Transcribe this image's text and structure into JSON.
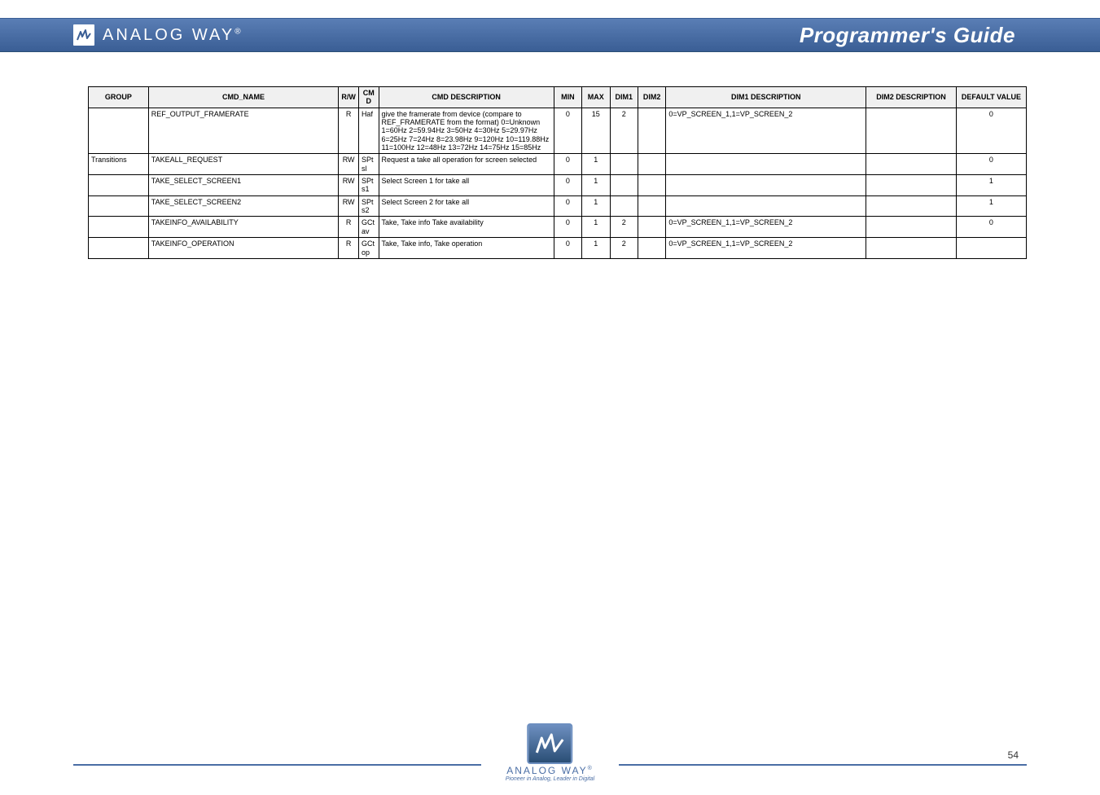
{
  "header": {
    "brand_text": "ANALOG WAY",
    "brand_reg": "®",
    "title": "Programmer's Guide"
  },
  "table": {
    "headers": {
      "group": "GROUP",
      "cmd_name": "CMD_NAME",
      "rw": "R/W",
      "cmd": "CMD",
      "cmd_descr": "CMD DESCRIPTION",
      "min": "MIN",
      "max": "MAX",
      "dim1": "DIM1",
      "dim2": "DIM2",
      "dim1_descr": "DIM1 DESCRIPTION",
      "dim2_descr": "DIM2 DESCRIPTION",
      "default": "DEFAULT VALUE"
    },
    "rows": [
      {
        "group": "",
        "cmd_name": "REF_OUTPUT_FRAMERATE",
        "rw": "R",
        "cmd": "Haf",
        "cmd_descr": "give the framerate from device (compare to REF_FRAMERATE from the format) 0=Unknown 1=60Hz 2=59.94Hz 3=50Hz 4=30Hz 5=29.97Hz 6=25Hz 7=24Hz 8=23.98Hz 9=120Hz 10=119.88Hz 11=100Hz 12=48Hz 13=72Hz 14=75Hz 15=85Hz",
        "min": "0",
        "max": "15",
        "dim1": "2",
        "dim2": "",
        "dim1_descr": "0=VP_SCREEN_1,1=VP_SCREEN_2",
        "dim2_descr": "",
        "default": "0"
      },
      {
        "group": "Transitions",
        "cmd_name": "TAKEALL_REQUEST",
        "rw": "RW",
        "cmd": "SPtsl",
        "cmd_descr": "Request a take all operation for screen selected",
        "min": "0",
        "max": "1",
        "dim1": "",
        "dim2": "",
        "dim1_descr": "",
        "dim2_descr": "",
        "default": "0"
      },
      {
        "group": "",
        "cmd_name": "TAKE_SELECT_SCREEN1",
        "rw": "RW",
        "cmd": "SPts1",
        "cmd_descr": "Select Screen 1 for take all",
        "min": "0",
        "max": "1",
        "dim1": "",
        "dim2": "",
        "dim1_descr": "",
        "dim2_descr": "",
        "default": "1"
      },
      {
        "group": "",
        "cmd_name": "TAKE_SELECT_SCREEN2",
        "rw": "RW",
        "cmd": "SPts2",
        "cmd_descr": "Select Screen 2 for take all",
        "min": "0",
        "max": "1",
        "dim1": "",
        "dim2": "",
        "dim1_descr": "",
        "dim2_descr": "",
        "default": "1"
      },
      {
        "group": "",
        "cmd_name": "TAKEINFO_AVAILABILITY",
        "rw": "R",
        "cmd": "GCtav",
        "cmd_descr": "Take, Take info Take availability",
        "min": "0",
        "max": "1",
        "dim1": "2",
        "dim2": "",
        "dim1_descr": "0=VP_SCREEN_1,1=VP_SCREEN_2",
        "dim2_descr": "",
        "default": "0"
      },
      {
        "group": "",
        "cmd_name": "TAKEINFO_OPERATION",
        "rw": "R",
        "cmd": "GCtop",
        "cmd_descr": "Take, Take info, Take operation",
        "min": "0",
        "max": "1",
        "dim1": "2",
        "dim2": "",
        "dim1_descr": "0=VP_SCREEN_1,1=VP_SCREEN_2",
        "dim2_descr": "",
        "default": ""
      }
    ]
  },
  "footer": {
    "brand_text": "ANALOG WAY",
    "brand_reg": "®",
    "tagline": "Pioneer in Analog, Leader in Digital",
    "page": "54"
  }
}
